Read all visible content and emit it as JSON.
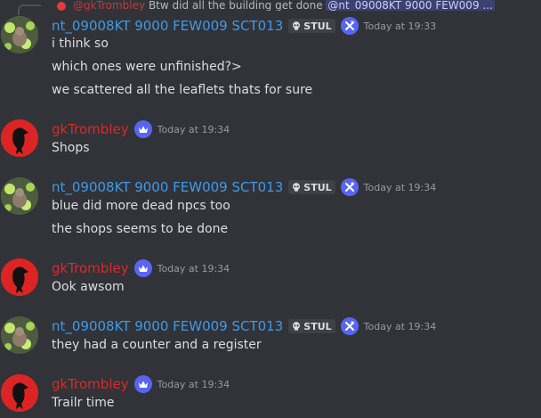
{
  "reply": {
    "author": "@gkTrombley",
    "text": "Btw did all the building get done",
    "mention": "@nt_09008KT 9000 FEW009 ..."
  },
  "messages": [
    {
      "author": "nt_09008KT 9000 FEW009 SCT013",
      "tag": "STUL",
      "timestamp": "Today at 19:33",
      "lines": [
        "i think so",
        "which ones were unfinished?>",
        "we scattered all the leaflets thats for sure"
      ]
    },
    {
      "author": "gkTrombley",
      "timestamp": "Today at 19:34",
      "lines": [
        "Shops"
      ]
    },
    {
      "author": "nt_09008KT 9000 FEW009 SCT013",
      "tag": "STUL",
      "timestamp": "Today at 19:34",
      "lines": [
        "blue did more dead npcs too",
        "the shops seems to be done"
      ]
    },
    {
      "author": "gkTrombley",
      "timestamp": "Today at 19:34",
      "lines": [
        "Ook awsom"
      ]
    },
    {
      "author": "nt_09008KT 9000 FEW009 SCT013",
      "tag": "STUL",
      "timestamp": "Today at 19:34",
      "lines": [
        "they had a counter and a register"
      ]
    },
    {
      "author": "gkTrombley",
      "timestamp": "Today at 19:34",
      "lines": [
        "Trailr time"
      ]
    }
  ],
  "colors": {
    "background": "#313338",
    "nt_name": "#3f9ae8",
    "gk_name": "#d92a2a",
    "badge": "#5865f2"
  },
  "icons": {
    "nt_badge": "wrench-hammer-icon",
    "gk_badge": "crown-icon",
    "tag": "skull-icon"
  }
}
